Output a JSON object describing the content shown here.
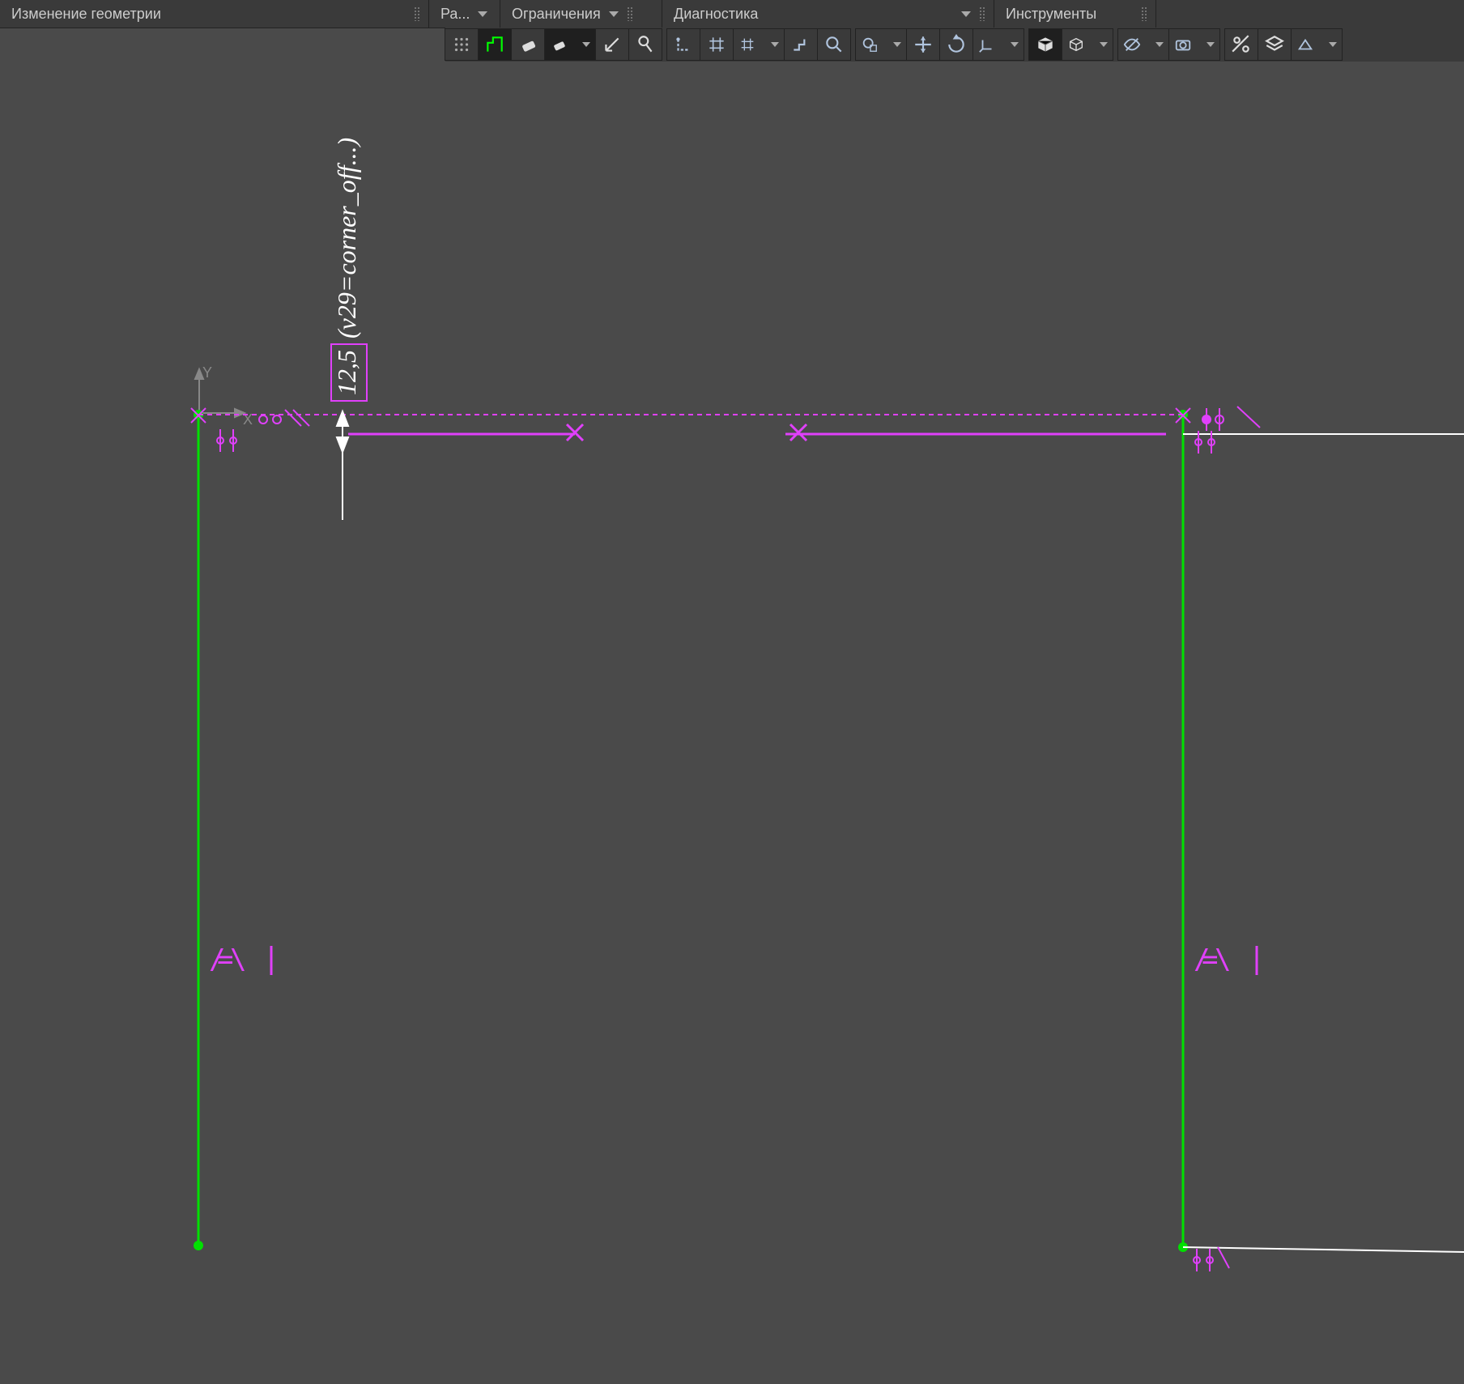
{
  "panels": {
    "p0": "Изменение геометрии",
    "p1": "Ра...",
    "p2": "Ограничения",
    "p3": "Диагностика",
    "p4": "Инструменты"
  },
  "toolbar_icons": [
    "grip-icon",
    "profile-icon",
    "eraser-icon",
    "eraser-dd-icon",
    "perpendicular-icon",
    "probe-icon",
    "snap-corner-icon",
    "snap-grid-icon",
    "snap-grid-dd-icon",
    "snap-step-icon",
    "zoom-icon",
    "zoom-region-icon",
    "axis-move-icon",
    "axis-rotate-icon",
    "csys-icon",
    "box-solid-icon",
    "box-wire-icon",
    "vis-hide-icon",
    "camera-icon",
    "settings-icon",
    "layers-icon",
    "export-icon"
  ],
  "sketch": {
    "origin_label_x": "X",
    "origin_label_y": "Y",
    "dim_value": "12,5",
    "dim_formula": "(v29=corner_off...)",
    "constraint_glyph": "/=\\",
    "colors": {
      "geom": "#00e000",
      "constraint": "#e040fb",
      "ref": "#ffffff",
      "subtle": "#808080"
    }
  }
}
